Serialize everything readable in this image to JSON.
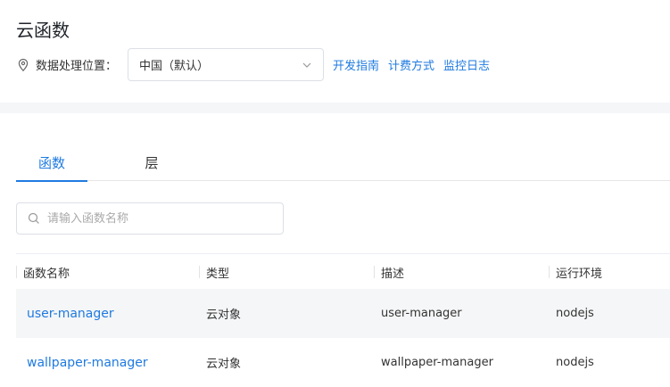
{
  "page": {
    "title": "云函数"
  },
  "region": {
    "label": "数据处理位置：",
    "selected": "中国（默认）",
    "links": [
      "开发指南",
      "计费方式",
      "监控日志"
    ]
  },
  "tabs": [
    {
      "label": "函数",
      "active": true
    },
    {
      "label": "层",
      "active": false
    }
  ],
  "search": {
    "placeholder": "请输入函数名称",
    "value": ""
  },
  "table": {
    "columns": [
      "函数名称",
      "类型",
      "描述",
      "运行环境"
    ],
    "rows": [
      {
        "name": "user-manager",
        "type": "云对象",
        "description": "user-manager",
        "runtime": "nodejs"
      },
      {
        "name": "wallpaper-manager",
        "type": "云对象",
        "description": "wallpaper-manager",
        "runtime": "nodejs"
      }
    ]
  },
  "colors": {
    "accent": "#1f7ae0",
    "band": "#f5f6f7",
    "text": "#333333"
  }
}
